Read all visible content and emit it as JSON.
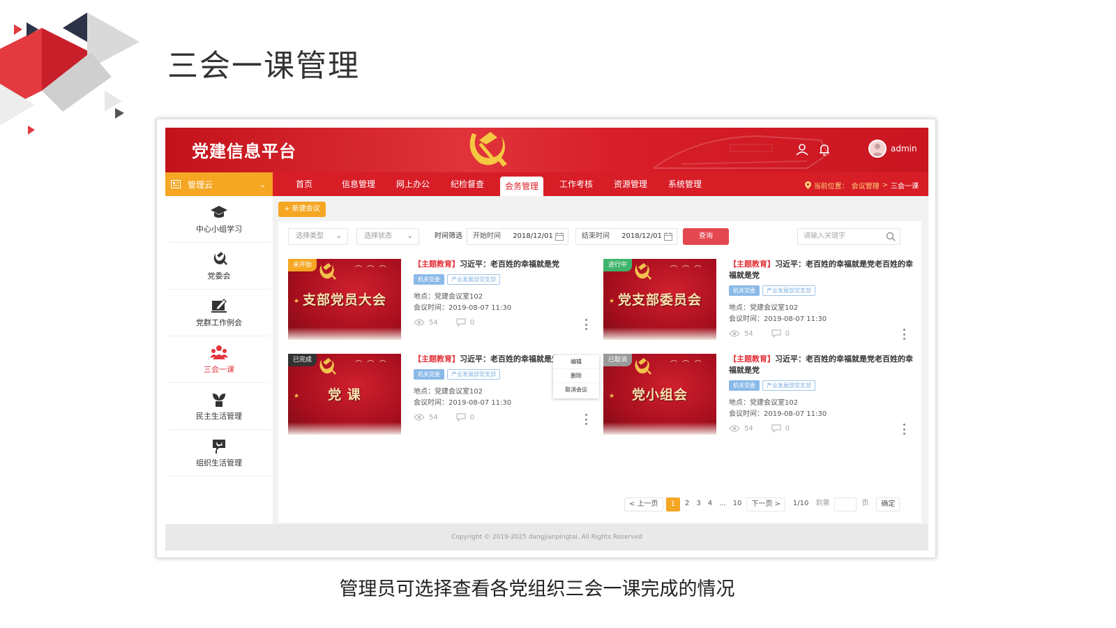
{
  "slide": {
    "title": "三会一课管理",
    "caption": "管理员可选择查看各党组织三会一课完成的情况"
  },
  "colors": {
    "brand_red": "#d71d26",
    "accent_orange": "#f5a623",
    "query_red": "#e3474f"
  },
  "header": {
    "platform_name": "党建信息平台",
    "user_icon": "user-icon",
    "bell_icon": "bell-icon",
    "username": "admin"
  },
  "nav": {
    "module": "管理云",
    "tabs": [
      "首页",
      "信息管理",
      "网上办公",
      "纪检督查",
      "会务管理",
      "工作考核",
      "资源管理",
      "系统管理"
    ],
    "active_tab": "会务管理",
    "breadcrumb": {
      "label": "当前位置：",
      "path": "会议管理",
      "sep": ">",
      "current": "三会一课"
    }
  },
  "sidebar": {
    "items": [
      {
        "label": "中心小组学习",
        "icon": "graduation-cap-icon"
      },
      {
        "label": "党委会",
        "icon": "hammer-sickle-icon"
      },
      {
        "label": "党群工作例会",
        "icon": "edit-icon"
      },
      {
        "label": "三会一课",
        "icon": "group-icon",
        "active": true
      },
      {
        "label": "民主生活管理",
        "icon": "plant-icon"
      },
      {
        "label": "组织生活管理",
        "icon": "flag-icon"
      }
    ]
  },
  "toolbar": {
    "new_button": "+ 新建会议"
  },
  "filters": {
    "type_placeholder": "选择类型",
    "status_placeholder": "选择状态",
    "time_filter_label": "时间筛选",
    "start_label": "开始时间",
    "start_value": "2018/12/01",
    "end_label": "结束时间",
    "end_value": "2018/12/01",
    "query_button": "查询",
    "search_placeholder": "请输入关键字"
  },
  "meetings": [
    {
      "thumb_title": "支部党员大会",
      "status": "未开始",
      "status_color": "#f5a623",
      "tag": "【主题教育】",
      "title": "习近平：老百姓的幸福就是党",
      "badges": [
        "机关党委",
        "产业发展部党支部"
      ],
      "location": "地点：党建会议室102",
      "time": "会议时间：2019-08-07 11:30",
      "views": "54",
      "comments": "0"
    },
    {
      "thumb_title": "党支部委员会",
      "status": "进行中",
      "status_color": "#3fb56b",
      "tag": "【主题教育】",
      "title": "习近平：老百姓的幸福就是党老百姓的幸福就是党",
      "badges": [
        "机关党委",
        "产业发展部党支部"
      ],
      "location": "地点：党建会议室102",
      "time": "会议时间：2019-08-07 11:30",
      "views": "54",
      "comments": "0"
    },
    {
      "thumb_title": "党 课",
      "status": "已完成",
      "status_color": "#333333",
      "tag": "【主题教育】",
      "title": "习近平：老百姓的幸福就是党",
      "badges": [
        "机关党委",
        "产业发展部党支部"
      ],
      "location": "地点：党建会议室102",
      "time": "会议时间：2019-08-07 11:30",
      "views": "54",
      "comments": "0"
    },
    {
      "thumb_title": "党小组会",
      "status": "已取消",
      "status_color": "#9a9a9a",
      "tag": "【主题教育】",
      "title": "习近平：老百姓的幸福就是党老百姓的幸福就是党",
      "badges": [
        "机关党委",
        "产业发展部党支部"
      ],
      "location": "地点：党建会议室102",
      "time": "会议时间：2019-08-07 11:30",
      "views": "54",
      "comments": "0"
    }
  ],
  "context_menu": [
    "编辑",
    "删除",
    "取消会议"
  ],
  "pagination": {
    "prev": "< 上一页",
    "pages": [
      "1",
      "2",
      "3",
      "4",
      "...",
      "10"
    ],
    "current": "1",
    "next": "下一页 >",
    "page_info": "1/10",
    "goto_label": "到第",
    "page_suffix": "页",
    "confirm": "确定"
  },
  "footer": {
    "copyright": "Copyright © 2019-2025 dangjianpingtai, All Rights Reserved"
  }
}
